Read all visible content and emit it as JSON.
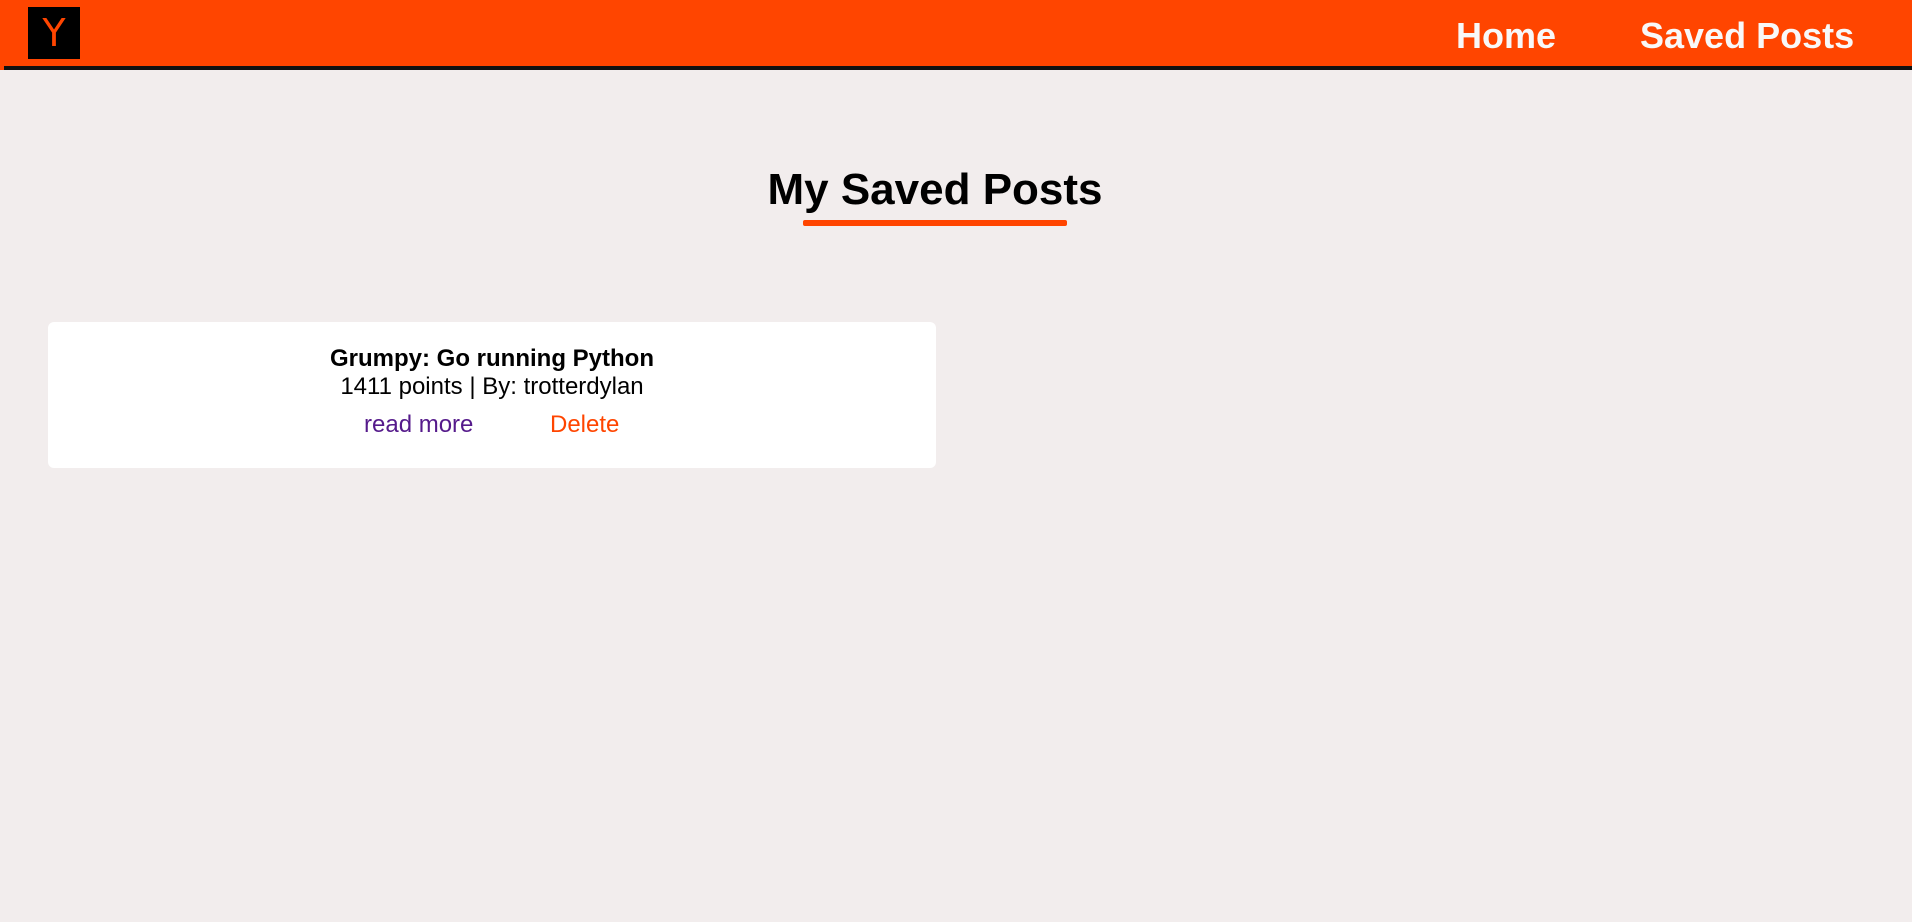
{
  "header": {
    "logo_letter": "Y",
    "nav": {
      "home": "Home",
      "saved_posts": "Saved Posts"
    }
  },
  "main": {
    "title": "My Saved Posts",
    "posts": [
      {
        "title": "Grumpy: Go running Python",
        "points": "1411",
        "points_label": "points",
        "separator": "|",
        "by_label": "By:",
        "author": "trotterdylan",
        "read_more_label": "read more",
        "delete_label": "Delete"
      }
    ]
  },
  "colors": {
    "brand": "#ff4500",
    "background": "#f2eded",
    "card": "#ffffff",
    "visited_link": "#551a8b"
  }
}
